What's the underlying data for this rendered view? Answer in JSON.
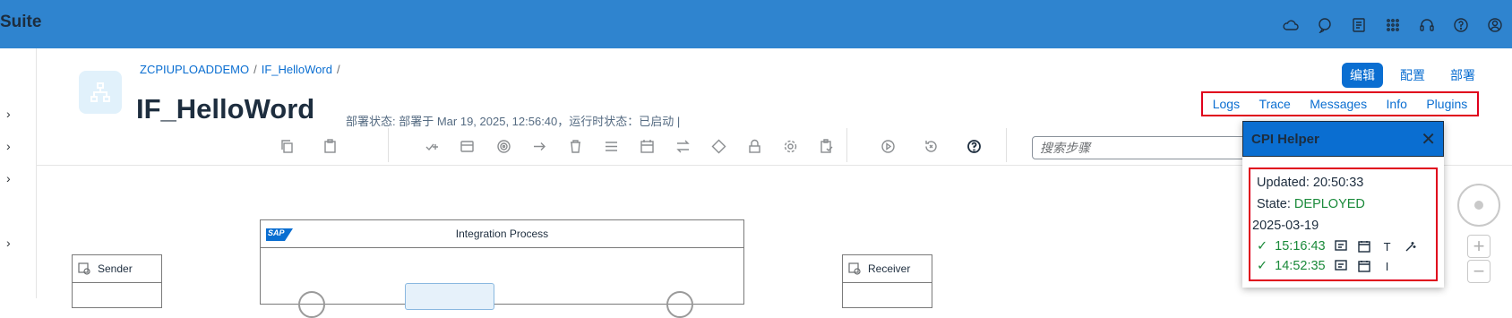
{
  "shell": {
    "brand": "Suite",
    "icons": [
      "cloud-icon",
      "chat-icon",
      "notes-icon",
      "app-grid-icon",
      "headset-icon",
      "help-icon",
      "user-icon"
    ]
  },
  "breadcrumb": {
    "items": [
      "ZCPIUPLOADDEMO",
      "IF_HelloWord"
    ],
    "separator": "/"
  },
  "header": {
    "title": "IF_HelloWord",
    "status": "部署状态: 部署于 Mar 19, 2025, 12:56:40，运行时状态：已启动 |"
  },
  "modes": {
    "edit": "编辑",
    "configure": "配置",
    "deploy": "部署"
  },
  "plugin_bar": {
    "logs": "Logs",
    "trace": "Trace",
    "messages": "Messages",
    "info": "Info",
    "plugins": "Plugins"
  },
  "toolbar": {
    "search_placeholder": "搜索步骤",
    "icons": [
      "copy-icon",
      "paste-icon",
      "add-icon",
      "window-icon",
      "target-icon",
      "arrow-right-icon",
      "delete-icon",
      "list-icon",
      "calendar-icon",
      "swap-icon",
      "diamond-icon",
      "lock-icon",
      "settings-icon",
      "clipboard-icon",
      "play-icon",
      "history-icon",
      "help-icon"
    ]
  },
  "canvas": {
    "process_title": "Integration Process",
    "sender": "Sender",
    "receiver": "Receiver",
    "sap_logo": "SAP"
  },
  "helper": {
    "title": "CPI Helper",
    "close": "✕",
    "updated_label": "Updated:",
    "updated_value": "20:50:33",
    "state_label": "State:",
    "state_value": "DEPLOYED",
    "date": "2025-03-19",
    "runs": [
      {
        "time": "15:16:43",
        "letter": "T",
        "status_color": "#1a8a3a"
      },
      {
        "time": "14:52:35",
        "letter": "I",
        "status_color": "#1a8a3a"
      }
    ]
  },
  "colors": {
    "shell_bar": "#2f84cf",
    "accent": "#0a6ed1",
    "highlight_border": "#e0001c",
    "success": "#1a8a3a"
  }
}
